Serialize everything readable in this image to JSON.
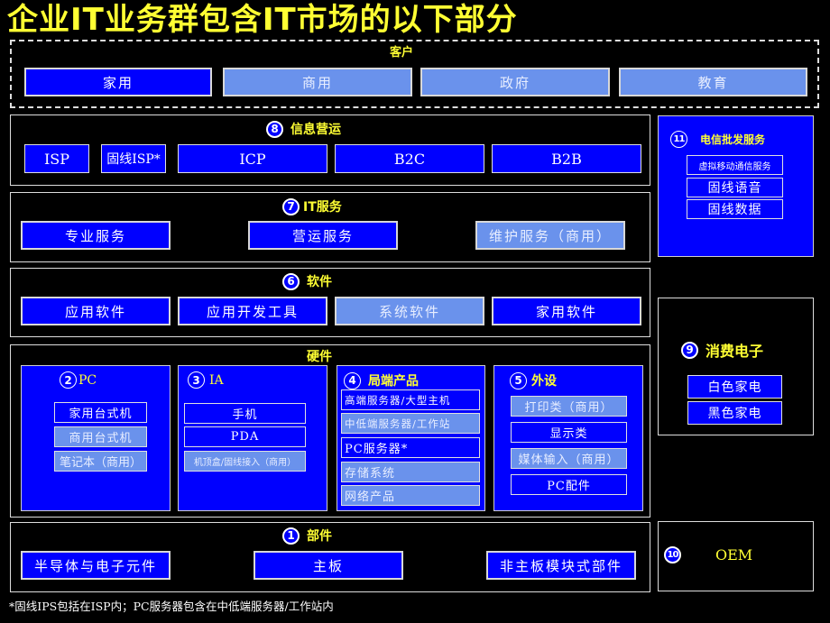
{
  "title": "企业IT业务群包含IT市场的以下部分",
  "customers": {
    "label": "客户",
    "items": [
      {
        "label": "家用",
        "style": "dark"
      },
      {
        "label": "商用",
        "style": "light"
      },
      {
        "label": "政府",
        "style": "light"
      },
      {
        "label": "教育",
        "style": "light"
      }
    ]
  },
  "info_ops": {
    "number": "8",
    "label": "信息营运",
    "items": [
      {
        "label": "ISP",
        "style": "dark"
      },
      {
        "label": "固线ISP*",
        "style": "dark"
      },
      {
        "label": "ICP",
        "style": "dark"
      },
      {
        "label": "B2C",
        "style": "dark"
      },
      {
        "label": "B2B",
        "style": "dark"
      }
    ]
  },
  "it_services": {
    "number": "7",
    "label": "IT服务",
    "items": [
      {
        "label": "专业服务",
        "style": "dark"
      },
      {
        "label": "营运服务",
        "style": "dark"
      },
      {
        "label": "维护服务（商用）",
        "style": "light"
      }
    ]
  },
  "software": {
    "number": "6",
    "label": "软件",
    "items": [
      {
        "label": "应用软件",
        "style": "dark"
      },
      {
        "label": "应用开发工具",
        "style": "dark"
      },
      {
        "label": "系统软件",
        "style": "light"
      },
      {
        "label": "家用软件",
        "style": "dark"
      }
    ]
  },
  "hardware": {
    "label": "硬件",
    "pc": {
      "number": "2",
      "label": "PC",
      "items": [
        {
          "label": "家用台式机",
          "style": "dark"
        },
        {
          "label": "商用台式机",
          "style": "light"
        },
        {
          "label": "笔记本（商用）",
          "style": "light"
        }
      ]
    },
    "ia": {
      "number": "3",
      "label": "IA",
      "items": [
        {
          "label": "手机",
          "style": "dark"
        },
        {
          "label": "PDA",
          "style": "dark"
        },
        {
          "label": "机顶盒/固线接入（商用）",
          "style": "light"
        }
      ]
    },
    "enterprise": {
      "number": "4",
      "label": "局端产品",
      "items": [
        {
          "label": "高端服务器/大型主机",
          "style": "dark"
        },
        {
          "label": "中低端服务器/工作站",
          "style": "light"
        },
        {
          "label": "PC服务器*",
          "style": "dark"
        },
        {
          "label": "存储系统",
          "style": "light"
        },
        {
          "label": "网络产品",
          "style": "light"
        }
      ]
    },
    "peripherals": {
      "number": "5",
      "label": "外设",
      "items": [
        {
          "label": "打印类（商用）",
          "style": "light"
        },
        {
          "label": "显示类",
          "style": "dark"
        },
        {
          "label": "媒体输入（商用）",
          "style": "light"
        },
        {
          "label": "PC配件",
          "style": "dark"
        }
      ]
    }
  },
  "components": {
    "number": "1",
    "label": "部件",
    "items": [
      {
        "label": "半导体与电子元件",
        "style": "dark"
      },
      {
        "label": "主板",
        "style": "dark"
      },
      {
        "label": "非主板模块式部件",
        "style": "dark"
      }
    ]
  },
  "telecom_wholesale": {
    "number": "11",
    "label": "电信批发服务",
    "items": [
      {
        "label": "虚拟移动通信服务",
        "style": "dark"
      },
      {
        "label": "固线语音",
        "style": "dark"
      },
      {
        "label": "固线数据",
        "style": "dark"
      }
    ]
  },
  "consumer_electronics": {
    "number": "9",
    "label": "消费电子",
    "items": [
      {
        "label": "白色家电",
        "style": "dark"
      },
      {
        "label": "黑色家电",
        "style": "dark"
      }
    ]
  },
  "oem": {
    "number": "10",
    "label": "OEM"
  },
  "footnote": "*固线IPS包括在ISP内；PC服务器包含在中低端服务器/工作站内",
  "colors": {
    "background": "#000000",
    "dark_box": "#0000ff",
    "light_box": "#6a92ec",
    "heading": "#ffff33"
  }
}
